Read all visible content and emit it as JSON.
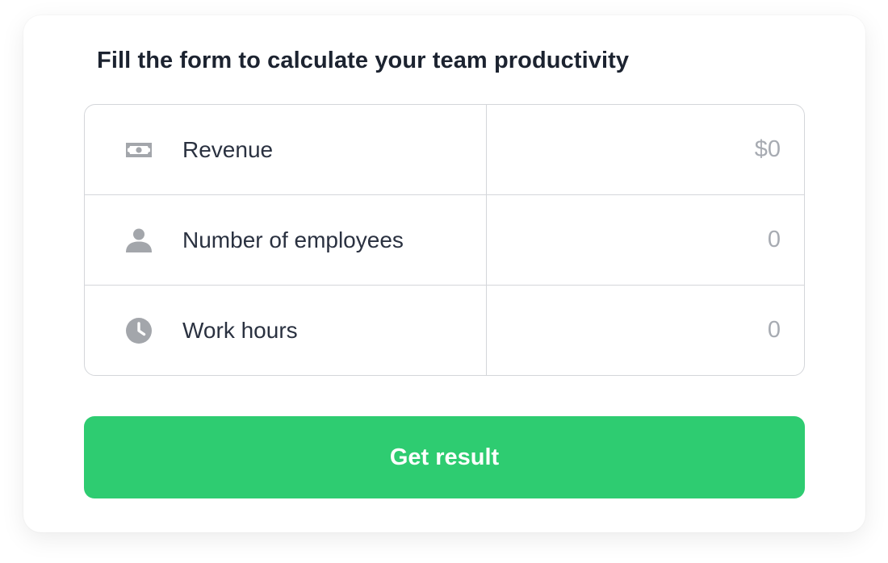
{
  "form": {
    "title": "Fill the form to calculate your team productivity",
    "fields": [
      {
        "label": "Revenue",
        "icon": "money-icon",
        "value": "",
        "placeholder": "$0"
      },
      {
        "label": "Number of employees",
        "icon": "person-icon",
        "value": "",
        "placeholder": "0"
      },
      {
        "label": "Work hours",
        "icon": "clock-icon",
        "value": "",
        "placeholder": "0"
      }
    ],
    "submit_label": "Get result"
  },
  "colors": {
    "accent": "#2ecc71",
    "icon": "#a3a6ab",
    "text": "#2a3140",
    "placeholder": "#a7abb2",
    "border": "#d4d6da"
  }
}
